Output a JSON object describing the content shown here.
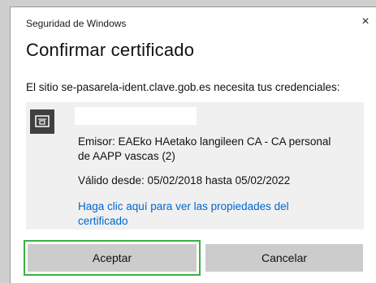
{
  "window": {
    "title": "Seguridad de Windows",
    "close_glyph": "×"
  },
  "dialog": {
    "heading": "Confirmar certificado",
    "message": "El sitio se-pasarela-ident.clave.gob.es necesita tus credenciales:"
  },
  "certificate": {
    "icon": "certificate-icon",
    "issuer": "Emisor: EAEko HAetako langileen CA - CA personal de AAPP vascas (2)",
    "validity": "Válido desde: 05/02/2018 hasta 05/02/2022",
    "properties_link": "Haga clic aquí para ver las propiedades del certificado"
  },
  "buttons": {
    "accept": "Aceptar",
    "cancel": "Cancelar"
  },
  "colors": {
    "accent_link": "#0066cc",
    "highlight": "#3cb043",
    "button_bg": "#cccccc",
    "cert_panel_bg": "#f0f0f0"
  }
}
